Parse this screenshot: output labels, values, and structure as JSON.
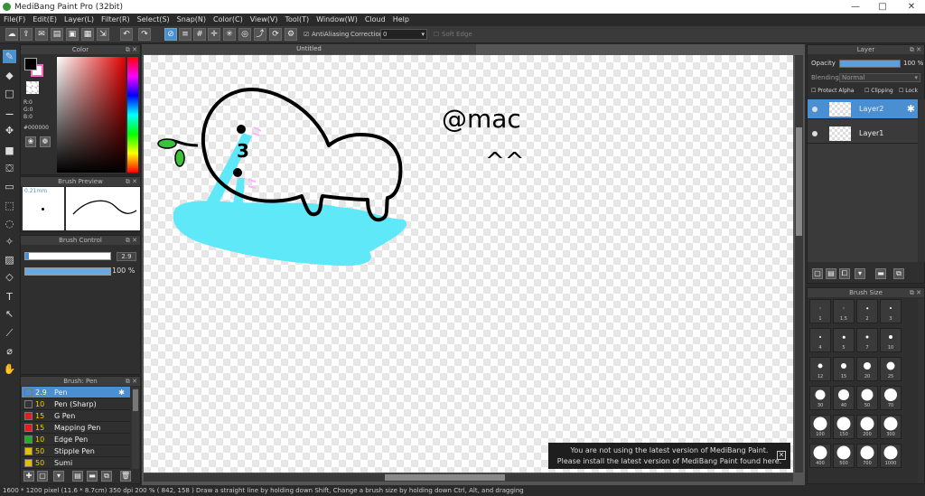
{
  "window": {
    "title": "MediBang Paint Pro (32bit)"
  },
  "menu": [
    "File(F)",
    "Edit(E)",
    "Layer(L)",
    "Filter(R)",
    "Select(S)",
    "Snap(N)",
    "Color(C)",
    "View(V)",
    "Tool(T)",
    "Window(W)",
    "Cloud",
    "Help"
  ],
  "toolbar": {
    "antialias": "AntiAliasing",
    "correction_label": "Correction",
    "correction_value": "0",
    "soft_edge": "Soft Edge"
  },
  "color_panel": {
    "title": "Color",
    "r": "R:0",
    "g": "G:0",
    "b": "B:0",
    "hex": "#000000",
    "primary": "#000000",
    "secondary": "#ff66cc"
  },
  "brush_preview": {
    "title": "Brush Preview",
    "size": "0.21mm"
  },
  "brush_control": {
    "title": "Brush Control",
    "size": "2.9",
    "opacity": "100 %"
  },
  "brush_list": {
    "title": "Brush: Pen",
    "items": [
      {
        "size": "2.9",
        "name": "Pen",
        "color": "#4a8fd1"
      },
      {
        "size": "10",
        "name": "Pen (Sharp)",
        "color": "#333333"
      },
      {
        "size": "15",
        "name": "G Pen",
        "color": "#e02020"
      },
      {
        "size": "15",
        "name": "Mapping Pen",
        "color": "#e02020"
      },
      {
        "size": "10",
        "name": "Edge Pen",
        "color": "#20b020"
      },
      {
        "size": "50",
        "name": "Stipple Pen",
        "color": "#e0c000"
      },
      {
        "size": "50",
        "name": "Sumi",
        "color": "#e0c000"
      }
    ]
  },
  "document": {
    "tab": "Untitled"
  },
  "layer_panel": {
    "title": "Layer",
    "opacity_label": "Opacity",
    "opacity_value": "100 %",
    "opacity": 1.0,
    "blending_label": "Blending",
    "blending_value": "Normal",
    "protect_alpha": "Protect Alpha",
    "clipping": "Clipping",
    "lock": "Lock",
    "layers": [
      {
        "name": "Layer2",
        "selected": true
      },
      {
        "name": "Layer1",
        "selected": false
      }
    ]
  },
  "brush_size": {
    "title": "Brush Size",
    "sizes": [
      "1",
      "1.5",
      "2",
      "3",
      "4",
      "5",
      "7",
      "10",
      "12",
      "15",
      "20",
      "25",
      "30",
      "40",
      "50",
      "70",
      "100",
      "150",
      "200",
      "300",
      "400",
      "500",
      "700",
      "1000"
    ]
  },
  "notice": {
    "line1": "You are not using the latest version of MediBang Paint.",
    "line2": "Please install the latest version of MediBang Paint found here."
  },
  "status": {
    "text": "1600 * 1200 pixel   (11.6 * 8.7cm)   350 dpi   200 %   ( 842, 158 )   Draw a straight line by holding down Shift, Change a brush size by holding down Ctrl, Alt, and dragging"
  },
  "drawing": {
    "handle": "@mac",
    "face": "^^"
  }
}
